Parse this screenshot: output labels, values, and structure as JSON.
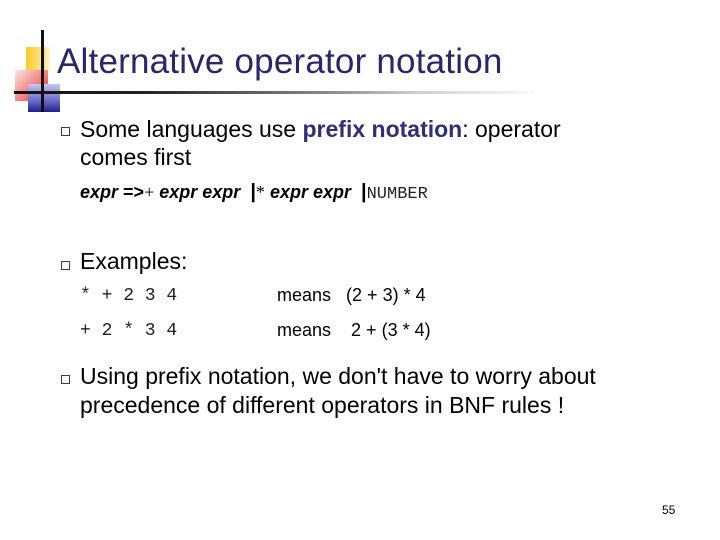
{
  "slide": {
    "title": "Alternative operator notation",
    "page_number": "55"
  },
  "bullets": [
    {
      "line1_pre": "Some languages use ",
      "line1_highlight": "prefix notation",
      "line1_post": ": operator",
      "line2": "comes first"
    },
    {
      "line1": "Examples:"
    },
    {
      "line1": "Using prefix notation, we don't have to worry about",
      "line2": "precedence of different operators in BNF rules !"
    }
  ],
  "grammar": {
    "lhs": "expr",
    "arrow": "=>",
    "plus": "+",
    "alt1": "expr expr",
    "pipe": "|",
    "star": "*",
    "alt2": "expr expr",
    "number": "NUMBER"
  },
  "examples": [
    {
      "code": "* + 2 3 4",
      "means_label": "means",
      "meaning": "(2 + 3) * 4"
    },
    {
      "code": "+ 2 * 3 4",
      "means_label": "means",
      "meaning": " 2 + (3 * 4)"
    }
  ],
  "colors": {
    "title": "#27276b",
    "highlight": "#2e2e7a"
  }
}
